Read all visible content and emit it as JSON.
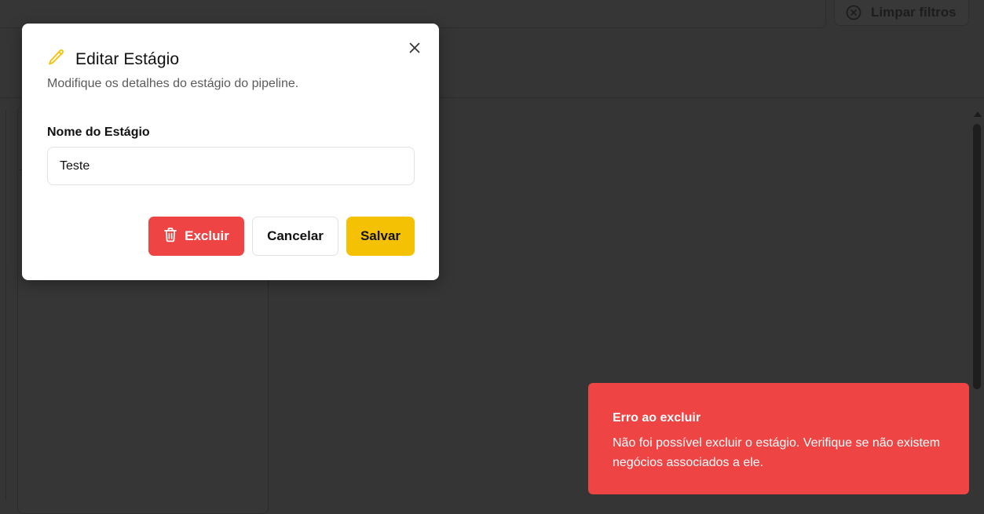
{
  "background": {
    "clear_filters_label": "Limpar filtros"
  },
  "modal": {
    "title": "Editar Estágio",
    "description": "Modifique os detalhes do estágio do pipeline.",
    "field_label": "Nome do Estágio",
    "field_value": "Teste",
    "delete_label": "Excluir",
    "cancel_label": "Cancelar",
    "save_label": "Salvar"
  },
  "toast": {
    "title": "Erro ao excluir",
    "message": "Não foi possível excluir o estágio. Verifique se não existem negócios associados a ele."
  },
  "colors": {
    "danger": "#ef4444",
    "primary": "#f5c105",
    "overlay": "#353535"
  }
}
